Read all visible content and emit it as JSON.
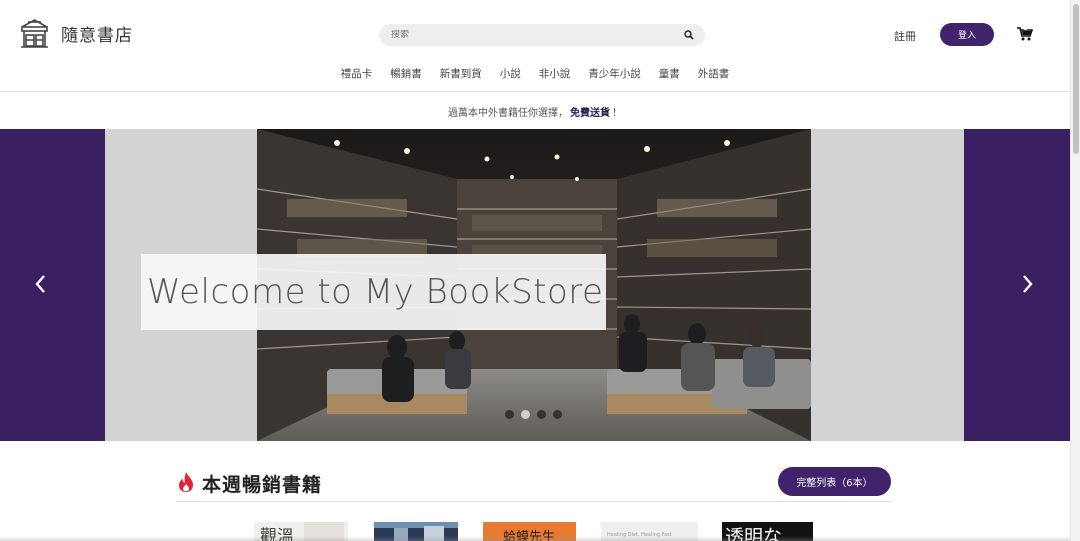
{
  "header": {
    "logo_text": "隨意書店",
    "search": {
      "placeholder": "搜索"
    },
    "register_label": "註冊",
    "login_label": "登入",
    "cart_count": "0"
  },
  "nav": {
    "items": [
      {
        "label": "禮品卡"
      },
      {
        "label": "暢銷書"
      },
      {
        "label": "新書到貨"
      },
      {
        "label": "小說"
      },
      {
        "label": "非小說"
      },
      {
        "label": "青少年小說"
      },
      {
        "label": "童書"
      },
      {
        "label": "外語書"
      }
    ]
  },
  "promo": {
    "text_before": "過萬本中外書籍任你選擇，",
    "highlight": "免費送貨",
    "text_after": "！"
  },
  "hero": {
    "caption": "Welcome to My BookStore",
    "slide_count": 4,
    "active_slide": 2
  },
  "bestsellers": {
    "title": "本週暢銷書籍",
    "full_list_label": "完整列表（6本）",
    "books": [
      {
        "cover_text": "觀溫"
      },
      {
        "cover_text": ""
      },
      {
        "cover_text": "蛤蟆先生"
      },
      {
        "cover_text": "Healing Diet, Healing Fast"
      },
      {
        "cover_text": "透明な"
      }
    ]
  },
  "colors": {
    "brand_purple": "#40236b",
    "side_panel": "#3b1f63",
    "promo_highlight": "#2d1f4f",
    "fire": "#e0253a"
  }
}
